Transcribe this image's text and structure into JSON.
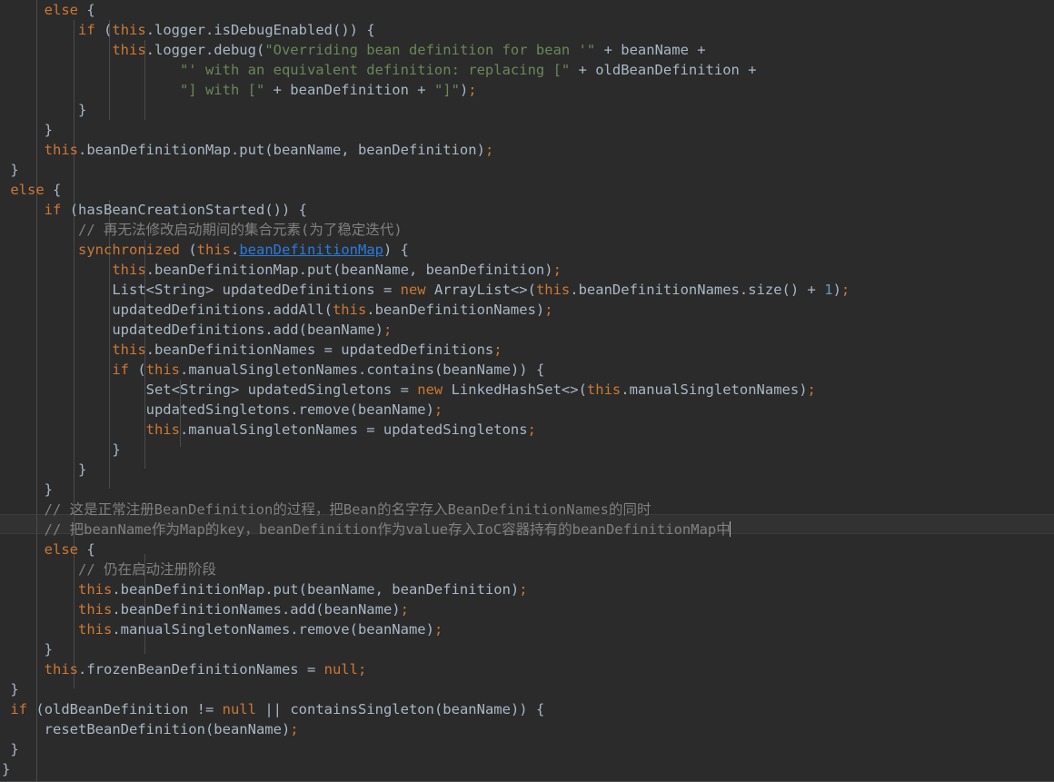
{
  "editor": {
    "language": "java",
    "theme": "darcula",
    "background_color": "#2b2b2b",
    "default_text_color": "#a9b7c6",
    "keyword_color": "#cc7832",
    "string_color": "#6a8759",
    "comment_color": "#808080",
    "number_color": "#6897bb",
    "link_color": "#287bde",
    "current_line_color": "#323232",
    "indent_guide_color": "#4b4b4b",
    "caret_color": "#bbbbbb",
    "current_line_number": 27,
    "line_height_px": 22,
    "font_size_px": 15.5
  },
  "code": {
    "lines": [
      {
        "n": 1,
        "indent": 4,
        "text": "else {"
      },
      {
        "n": 2,
        "indent": 6,
        "text": "if (this.logger.isDebugEnabled()) {"
      },
      {
        "n": 3,
        "indent": 8,
        "text": "this.logger.debug(\"Overriding bean definition for bean '\" + beanName +"
      },
      {
        "n": 4,
        "indent": 12,
        "text": "\"' with an equivalent definition: replacing [\" + oldBeanDefinition +"
      },
      {
        "n": 5,
        "indent": 12,
        "text": "\"] with [\" + beanDefinition + \"]\");"
      },
      {
        "n": 6,
        "indent": 6,
        "text": "}"
      },
      {
        "n": 7,
        "indent": 4,
        "text": "}"
      },
      {
        "n": 8,
        "indent": 4,
        "text": "this.beanDefinitionMap.put(beanName, beanDefinition);"
      },
      {
        "n": 9,
        "indent": 2,
        "text": "}"
      },
      {
        "n": 10,
        "indent": 2,
        "text": "else {"
      },
      {
        "n": 11,
        "indent": 4,
        "text": "if (hasBeanCreationStarted()) {"
      },
      {
        "n": 12,
        "indent": 6,
        "text": "// 再无法修改启动期间的集合元素(为了稳定迭代)"
      },
      {
        "n": 13,
        "indent": 6,
        "text": "synchronized (this.beanDefinitionMap) {"
      },
      {
        "n": 14,
        "indent": 8,
        "text": "this.beanDefinitionMap.put(beanName, beanDefinition);"
      },
      {
        "n": 15,
        "indent": 8,
        "text": "List<String> updatedDefinitions = new ArrayList<>(this.beanDefinitionNames.size() + 1);"
      },
      {
        "n": 16,
        "indent": 8,
        "text": "updatedDefinitions.addAll(this.beanDefinitionNames);"
      },
      {
        "n": 17,
        "indent": 8,
        "text": "updatedDefinitions.add(beanName);"
      },
      {
        "n": 18,
        "indent": 8,
        "text": "this.beanDefinitionNames = updatedDefinitions;"
      },
      {
        "n": 19,
        "indent": 8,
        "text": "if (this.manualSingletonNames.contains(beanName)) {"
      },
      {
        "n": 20,
        "indent": 10,
        "text": "Set<String> updatedSingletons = new LinkedHashSet<>(this.manualSingletonNames);"
      },
      {
        "n": 21,
        "indent": 10,
        "text": "updatedSingletons.remove(beanName);"
      },
      {
        "n": 22,
        "indent": 10,
        "text": "this.manualSingletonNames = updatedSingletons;"
      },
      {
        "n": 23,
        "indent": 8,
        "text": "}"
      },
      {
        "n": 24,
        "indent": 6,
        "text": "}"
      },
      {
        "n": 25,
        "indent": 4,
        "text": "}"
      },
      {
        "n": 26,
        "indent": 4,
        "text": "// 这是正常注册BeanDefinition的过程，把Bean的名字存入BeanDefinitionNames的同时"
      },
      {
        "n": 27,
        "indent": 4,
        "text": "// 把beanName作为Map的key，beanDefinition作为value存入IoC容器持有的beanDefinitionMap中"
      },
      {
        "n": 28,
        "indent": 4,
        "text": "else {"
      },
      {
        "n": 29,
        "indent": 6,
        "text": "// 仍在启动注册阶段"
      },
      {
        "n": 30,
        "indent": 6,
        "text": "this.beanDefinitionMap.put(beanName, beanDefinition);"
      },
      {
        "n": 31,
        "indent": 6,
        "text": "this.beanDefinitionNames.add(beanName);"
      },
      {
        "n": 32,
        "indent": 6,
        "text": "this.manualSingletonNames.remove(beanName);"
      },
      {
        "n": 33,
        "indent": 4,
        "text": "}"
      },
      {
        "n": 34,
        "indent": 4,
        "text": "this.frozenBeanDefinitionNames = null;"
      },
      {
        "n": 35,
        "indent": 2,
        "text": "}"
      },
      {
        "n": 36,
        "indent": 2,
        "text": "if (oldBeanDefinition != null || containsSingleton(beanName)) {"
      },
      {
        "n": 37,
        "indent": 4,
        "text": "resetBeanDefinition(beanName);"
      },
      {
        "n": 38,
        "indent": 2,
        "text": "}"
      },
      {
        "n": 39,
        "indent": 0,
        "text": "}"
      }
    ],
    "comments": {
      "stale_iteration": "// 再无法修改启动期间的集合元素(为了稳定迭代)",
      "normal_registration_1": "// 这是正常注册BeanDefinition的过程，把Bean的名字存入BeanDefinitionNames的同时",
      "normal_registration_2": "// 把beanName作为Map的key，beanDefinition作为value存入IoC容器持有的beanDefinitionMap中",
      "still_startup": "// 仍在启动注册阶段"
    },
    "strings": [
      "\"Overriding bean definition for bean '\"",
      "\"' with an equivalent definition: replacing [\"",
      "\"] with [\"",
      "\"]\""
    ],
    "identifiers": [
      "beanDefinitionMap",
      "beanDefinitionNames",
      "manualSingletonNames",
      "frozenBeanDefinitionNames",
      "updatedDefinitions",
      "updatedSingletons",
      "beanName",
      "beanDefinition",
      "oldBeanDefinition",
      "hasBeanCreationStarted",
      "containsSingleton",
      "resetBeanDefinition",
      "isDebugEnabled",
      "logger"
    ],
    "keywords": [
      "else",
      "if",
      "new",
      "null",
      "synchronized"
    ],
    "types": [
      "List<String>",
      "ArrayList<>",
      "Set<String>",
      "LinkedHashSet<>"
    ],
    "numbers": [
      "1"
    ],
    "linked_symbol": "beanDefinitionMap"
  }
}
